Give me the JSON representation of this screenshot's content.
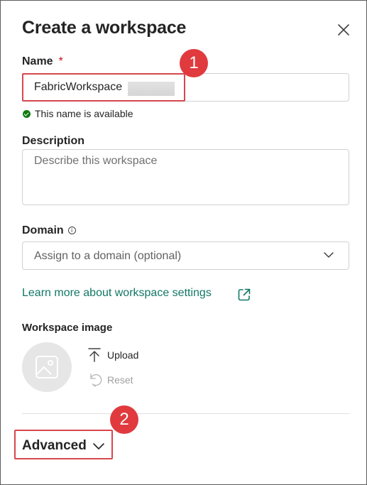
{
  "dialog": {
    "title": "Create a workspace"
  },
  "name_field": {
    "label": "Name",
    "required_mark": "*",
    "value": "FabricWorkspace",
    "status": "This name is available"
  },
  "description_field": {
    "label": "Description",
    "placeholder": "Describe this workspace"
  },
  "domain_field": {
    "label": "Domain",
    "info_glyph": "i",
    "placeholder": "Assign to a domain (optional)"
  },
  "learn_more": {
    "label": "Learn more about workspace settings"
  },
  "workspace_image": {
    "label": "Workspace image",
    "upload_label": "Upload",
    "reset_label": "Reset"
  },
  "advanced": {
    "label": "Advanced"
  },
  "callouts": {
    "badge_1": "1",
    "badge_2": "2"
  },
  "colors": {
    "link": "#117865",
    "success": "#107c10",
    "required": "#c50f1f",
    "callout": "#e03a3e"
  },
  "icons": [
    "close-icon",
    "check-circle-icon",
    "info-icon",
    "chevron-down-icon",
    "open-external-icon",
    "image-icon",
    "upload-icon",
    "undo-icon"
  ]
}
